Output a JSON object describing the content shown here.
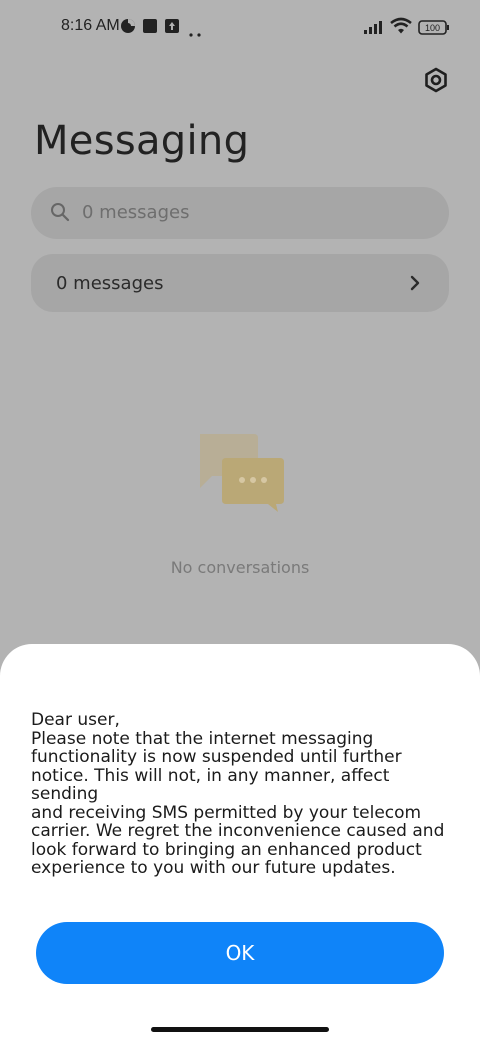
{
  "status_bar": {
    "time": "8:16 AM",
    "battery": "100",
    "icons": [
      "data-saver-icon",
      "square-notification-icon",
      "upload-notification-icon",
      "more-dots-icon",
      "signal-icon",
      "wifi-icon",
      "battery-icon"
    ]
  },
  "header": {
    "title": "Messaging",
    "settings_icon": "settings-hex-icon"
  },
  "search": {
    "placeholder": "0 messages",
    "icon": "search-icon"
  },
  "messages_row": {
    "label": "0 messages",
    "icon": "chevron-right-icon"
  },
  "empty_state": {
    "text": "No conversations",
    "icon": "chat-bubbles-icon"
  },
  "dialog": {
    "message": "Dear user,\nPlease note that the internet messaging\nfunctionality is now suspended until further\nnotice. This will not, in any manner, affect sending\nand receiving SMS permitted by your telecom\ncarrier. We regret the inconvenience caused and\nlook forward to bringing an enhanced product\nexperience to you with our future updates.",
    "ok_label": "OK"
  },
  "colors": {
    "dim_background": "#b3b3b3",
    "accent": "#0f84f9",
    "sheet": "#ffffff"
  }
}
